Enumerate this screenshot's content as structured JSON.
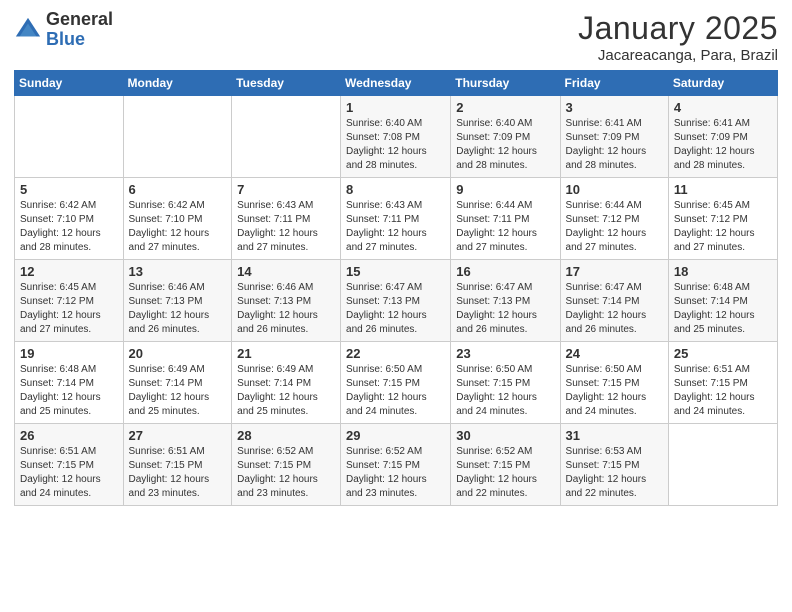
{
  "header": {
    "logo": {
      "general": "General",
      "blue": "Blue"
    },
    "title": "January 2025",
    "location": "Jacareacanga, Para, Brazil"
  },
  "weekdays": [
    "Sunday",
    "Monday",
    "Tuesday",
    "Wednesday",
    "Thursday",
    "Friday",
    "Saturday"
  ],
  "weeks": [
    [
      {
        "day": "",
        "info": ""
      },
      {
        "day": "",
        "info": ""
      },
      {
        "day": "",
        "info": ""
      },
      {
        "day": "1",
        "info": "Sunrise: 6:40 AM\nSunset: 7:08 PM\nDaylight: 12 hours\nand 28 minutes."
      },
      {
        "day": "2",
        "info": "Sunrise: 6:40 AM\nSunset: 7:09 PM\nDaylight: 12 hours\nand 28 minutes."
      },
      {
        "day": "3",
        "info": "Sunrise: 6:41 AM\nSunset: 7:09 PM\nDaylight: 12 hours\nand 28 minutes."
      },
      {
        "day": "4",
        "info": "Sunrise: 6:41 AM\nSunset: 7:09 PM\nDaylight: 12 hours\nand 28 minutes."
      }
    ],
    [
      {
        "day": "5",
        "info": "Sunrise: 6:42 AM\nSunset: 7:10 PM\nDaylight: 12 hours\nand 28 minutes."
      },
      {
        "day": "6",
        "info": "Sunrise: 6:42 AM\nSunset: 7:10 PM\nDaylight: 12 hours\nand 27 minutes."
      },
      {
        "day": "7",
        "info": "Sunrise: 6:43 AM\nSunset: 7:11 PM\nDaylight: 12 hours\nand 27 minutes."
      },
      {
        "day": "8",
        "info": "Sunrise: 6:43 AM\nSunset: 7:11 PM\nDaylight: 12 hours\nand 27 minutes."
      },
      {
        "day": "9",
        "info": "Sunrise: 6:44 AM\nSunset: 7:11 PM\nDaylight: 12 hours\nand 27 minutes."
      },
      {
        "day": "10",
        "info": "Sunrise: 6:44 AM\nSunset: 7:12 PM\nDaylight: 12 hours\nand 27 minutes."
      },
      {
        "day": "11",
        "info": "Sunrise: 6:45 AM\nSunset: 7:12 PM\nDaylight: 12 hours\nand 27 minutes."
      }
    ],
    [
      {
        "day": "12",
        "info": "Sunrise: 6:45 AM\nSunset: 7:12 PM\nDaylight: 12 hours\nand 27 minutes."
      },
      {
        "day": "13",
        "info": "Sunrise: 6:46 AM\nSunset: 7:13 PM\nDaylight: 12 hours\nand 26 minutes."
      },
      {
        "day": "14",
        "info": "Sunrise: 6:46 AM\nSunset: 7:13 PM\nDaylight: 12 hours\nand 26 minutes."
      },
      {
        "day": "15",
        "info": "Sunrise: 6:47 AM\nSunset: 7:13 PM\nDaylight: 12 hours\nand 26 minutes."
      },
      {
        "day": "16",
        "info": "Sunrise: 6:47 AM\nSunset: 7:13 PM\nDaylight: 12 hours\nand 26 minutes."
      },
      {
        "day": "17",
        "info": "Sunrise: 6:47 AM\nSunset: 7:14 PM\nDaylight: 12 hours\nand 26 minutes."
      },
      {
        "day": "18",
        "info": "Sunrise: 6:48 AM\nSunset: 7:14 PM\nDaylight: 12 hours\nand 25 minutes."
      }
    ],
    [
      {
        "day": "19",
        "info": "Sunrise: 6:48 AM\nSunset: 7:14 PM\nDaylight: 12 hours\nand 25 minutes."
      },
      {
        "day": "20",
        "info": "Sunrise: 6:49 AM\nSunset: 7:14 PM\nDaylight: 12 hours\nand 25 minutes."
      },
      {
        "day": "21",
        "info": "Sunrise: 6:49 AM\nSunset: 7:14 PM\nDaylight: 12 hours\nand 25 minutes."
      },
      {
        "day": "22",
        "info": "Sunrise: 6:50 AM\nSunset: 7:15 PM\nDaylight: 12 hours\nand 24 minutes."
      },
      {
        "day": "23",
        "info": "Sunrise: 6:50 AM\nSunset: 7:15 PM\nDaylight: 12 hours\nand 24 minutes."
      },
      {
        "day": "24",
        "info": "Sunrise: 6:50 AM\nSunset: 7:15 PM\nDaylight: 12 hours\nand 24 minutes."
      },
      {
        "day": "25",
        "info": "Sunrise: 6:51 AM\nSunset: 7:15 PM\nDaylight: 12 hours\nand 24 minutes."
      }
    ],
    [
      {
        "day": "26",
        "info": "Sunrise: 6:51 AM\nSunset: 7:15 PM\nDaylight: 12 hours\nand 24 minutes."
      },
      {
        "day": "27",
        "info": "Sunrise: 6:51 AM\nSunset: 7:15 PM\nDaylight: 12 hours\nand 23 minutes."
      },
      {
        "day": "28",
        "info": "Sunrise: 6:52 AM\nSunset: 7:15 PM\nDaylight: 12 hours\nand 23 minutes."
      },
      {
        "day": "29",
        "info": "Sunrise: 6:52 AM\nSunset: 7:15 PM\nDaylight: 12 hours\nand 23 minutes."
      },
      {
        "day": "30",
        "info": "Sunrise: 6:52 AM\nSunset: 7:15 PM\nDaylight: 12 hours\nand 22 minutes."
      },
      {
        "day": "31",
        "info": "Sunrise: 6:53 AM\nSunset: 7:15 PM\nDaylight: 12 hours\nand 22 minutes."
      },
      {
        "day": "",
        "info": ""
      }
    ]
  ]
}
